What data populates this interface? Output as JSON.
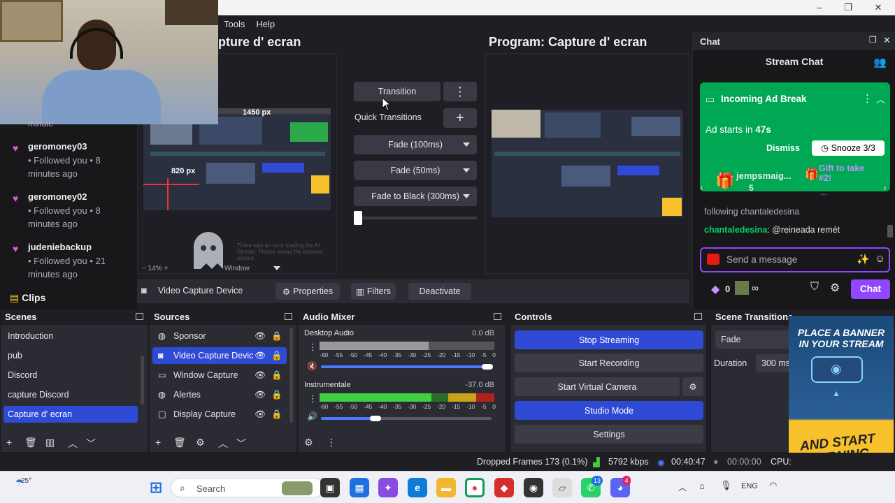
{
  "menubar": {
    "items": [
      "Tools",
      "Help"
    ]
  },
  "window_controls": {
    "minimize": "–",
    "restore": "❐",
    "close": "✕"
  },
  "preview": {
    "left_title": "pture d' ecran",
    "program_title": "Program: Capture d' ecran",
    "measure_1": "1450 px",
    "measure_2": "820 px",
    "ghost_text": "There was an error loading the AI Stream. Please reload the browser source.",
    "zoom_text": "14%",
    "window_label": "Window"
  },
  "transition_panel": {
    "transition_label": "Transition",
    "quick_transitions_label": "Quick Transitions",
    "dropdowns": [
      "Fade (100ms)",
      "Fade (50ms)",
      "Fade to Black (300ms)"
    ],
    "tbar_value": 0
  },
  "followers": {
    "partial_top": "minute",
    "items": [
      {
        "name": "geromoney03",
        "desc": "• Followed you • 8 minutes ago"
      },
      {
        "name": "geromoney02",
        "desc": "• Followed you • 8 minutes ago"
      },
      {
        "name": "judeniebackup",
        "desc": "• Followed you • 21 minutes ago"
      }
    ],
    "clips_label": "Clips"
  },
  "source_toolbar": {
    "source_name": "Video Capture Device",
    "properties": "Properties",
    "filters": "Filters",
    "deactivate": "Deactivate"
  },
  "chat": {
    "dock_title": "Chat",
    "stream_chat_title": "Stream Chat",
    "ad_break_title": "Incoming Ad Break",
    "ad_starts_prefix": "Ad starts in ",
    "ad_starts_time": "47s",
    "dismiss": "Dismiss",
    "snooze": "Snooze 3/3",
    "gifter_name": "jempsmaig...",
    "gifter_count": "5",
    "gift_text": "Gift to take #2!",
    "gift_dots": "...",
    "prev_message": "following chantaledesina",
    "message_user": "chantaledesina",
    "message_text": ": @reineada remét",
    "send_placeholder": "Send a message",
    "bits_count": "0",
    "infinity": "∞",
    "chat_button": "Chat"
  },
  "scenes": {
    "title": "Scenes",
    "items": [
      "Introduction",
      "pub",
      "Discord",
      "capture Discord",
      "Capture d' ecran"
    ],
    "selected_index": 4
  },
  "sources": {
    "title": "Sources",
    "items": [
      {
        "label": "Sponsor",
        "icon": "globe-icon"
      },
      {
        "label": "Video Capture Devic",
        "icon": "camera-icon"
      },
      {
        "label": "Window Capture",
        "icon": "window-icon"
      },
      {
        "label": "Alertes",
        "icon": "globe-icon"
      },
      {
        "label": "Display Capture",
        "icon": "monitor-icon"
      }
    ],
    "selected_index": 1
  },
  "audio_mixer": {
    "title": "Audio Mixer",
    "channels": [
      {
        "name": "Desktop Audio",
        "db": "0.0 dB",
        "volume": 1.0
      },
      {
        "name": "Instrumentale",
        "db": "-37.0 dB",
        "volume": 0.35
      }
    ],
    "scale": [
      "-60",
      "-55",
      "-50",
      "-45",
      "-40",
      "-35",
      "-30",
      "-25",
      "-20",
      "-15",
      "-10",
      "-5",
      "0"
    ]
  },
  "controls": {
    "title": "Controls",
    "stop_streaming": "Stop Streaming",
    "start_recording": "Start Recording",
    "start_virtual_camera": "Start Virtual Camera",
    "studio_mode": "Studio Mode",
    "settings": "Settings"
  },
  "scene_transitions": {
    "title": "Scene Transitions",
    "fade": "Fade",
    "duration_label": "Duration",
    "duration_value": "300 ms"
  },
  "status_bar": {
    "dropped_frames": "Dropped Frames 173 (0.1%)",
    "bitrate": "5792 kbps",
    "stream_time": "00:40:47",
    "rec_time": "00:00:00",
    "cpu": "CPU:"
  },
  "banner": {
    "top_text": "PLACE A BANNER IN YOUR STREAM",
    "bottom_text": "AND START EARNING TODAY!"
  },
  "taskbar": {
    "weather": "25°",
    "search": "Search",
    "lang": "ENG",
    "whatsapp_badge": "13",
    "discord_badge": "4"
  },
  "colors": {
    "accent_blue": "#2f4bd6",
    "twitch_purple": "#9147ff",
    "ad_green": "#00a854",
    "follow_heart": "#e05bd8"
  }
}
